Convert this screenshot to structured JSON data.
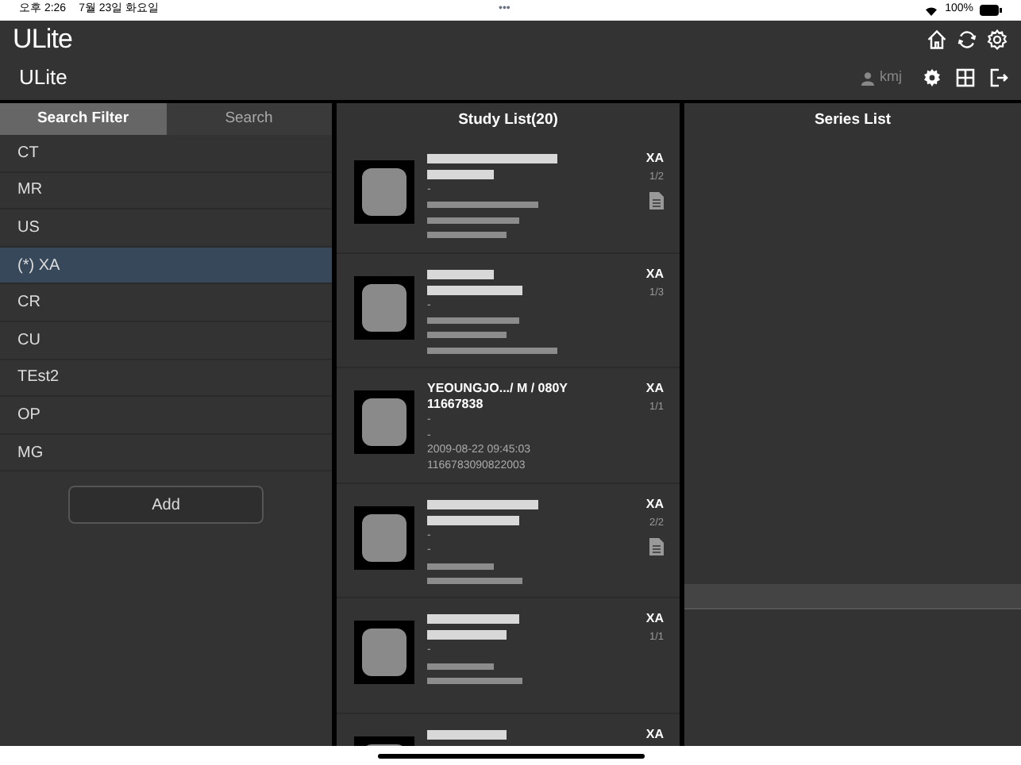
{
  "status_bar": {
    "time": "오후 2:26",
    "date": "7월 23일 화요일",
    "dots": "•••",
    "battery": "100%"
  },
  "app_header": {
    "logo": "ULite",
    "sub_logo": "ULite",
    "user": "kmj"
  },
  "filter_panel": {
    "tabs": [
      {
        "label": "Search Filter",
        "selected": true
      },
      {
        "label": "Search",
        "selected": false
      }
    ],
    "items": [
      {
        "label": "CT",
        "selected": false
      },
      {
        "label": "MR",
        "selected": false
      },
      {
        "label": "US",
        "selected": false
      },
      {
        "label": "(*) XA",
        "selected": true
      },
      {
        "label": "CR",
        "selected": false
      },
      {
        "label": "CU",
        "selected": false
      },
      {
        "label": "TEst2",
        "selected": false
      },
      {
        "label": "OP",
        "selected": false
      },
      {
        "label": "MG",
        "selected": false
      }
    ],
    "add_button": "Add"
  },
  "study_list": {
    "title": "Study List(20)",
    "studies": [
      {
        "modality": "XA",
        "count": "1/2",
        "has_report": true,
        "lines": [
          {
            "kind": "redacted_title"
          },
          {
            "kind": "redacted_title"
          },
          {
            "kind": "text",
            "text": "-"
          },
          {
            "kind": "redacted"
          },
          {
            "kind": "redacted"
          },
          {
            "kind": "redacted"
          }
        ]
      },
      {
        "modality": "XA",
        "count": "1/3",
        "has_report": false,
        "lines": [
          {
            "kind": "redacted_title"
          },
          {
            "kind": "redacted_title"
          },
          {
            "kind": "text",
            "text": "-"
          },
          {
            "kind": "redacted"
          },
          {
            "kind": "redacted"
          },
          {
            "kind": "redacted"
          }
        ]
      },
      {
        "modality": "XA",
        "count": "1/1",
        "has_report": false,
        "lines": [
          {
            "kind": "title",
            "text": "YEOUNGJO.../ M / 080Y"
          },
          {
            "kind": "title",
            "text": "11667838"
          },
          {
            "kind": "text",
            "text": "-"
          },
          {
            "kind": "text",
            "text": "-"
          },
          {
            "kind": "text",
            "text": "2009-08-22 09:45:03"
          },
          {
            "kind": "text",
            "text": "1166783090822003"
          }
        ]
      },
      {
        "modality": "XA",
        "count": "2/2",
        "has_report": true,
        "lines": [
          {
            "kind": "redacted_title"
          },
          {
            "kind": "redacted_title"
          },
          {
            "kind": "text",
            "text": "-"
          },
          {
            "kind": "text",
            "text": "-"
          },
          {
            "kind": "redacted"
          },
          {
            "kind": "redacted"
          }
        ]
      },
      {
        "modality": "XA",
        "count": "1/1",
        "has_report": false,
        "lines": [
          {
            "kind": "redacted_title"
          },
          {
            "kind": "redacted_title"
          },
          {
            "kind": "text",
            "text": "-"
          },
          {
            "kind": "redacted"
          },
          {
            "kind": "redacted"
          }
        ]
      },
      {
        "modality": "XA",
        "lines": [
          {
            "kind": "redacted_title"
          }
        ]
      }
    ]
  },
  "series_list": {
    "title": "Series List"
  }
}
